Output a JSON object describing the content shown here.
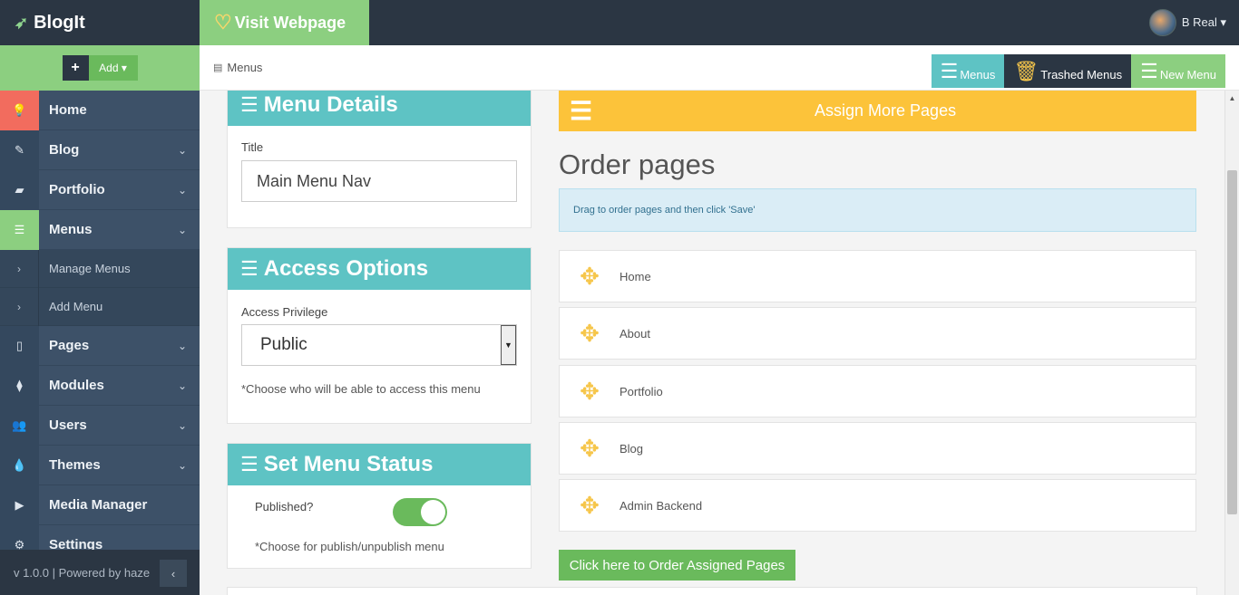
{
  "brand": {
    "name": "BlogIt",
    "icon": "rocket-icon"
  },
  "add_button": {
    "plus": "+",
    "label": "Add ▾"
  },
  "sidebar": {
    "items": [
      {
        "label": "Home",
        "icon": "lightbulb-icon",
        "glyph": "💡",
        "chevron": ""
      },
      {
        "label": "Blog",
        "icon": "edit-icon",
        "glyph": "✎",
        "chevron": "⌄"
      },
      {
        "label": "Portfolio",
        "icon": "briefcase-icon",
        "glyph": "▰",
        "chevron": "⌄"
      },
      {
        "label": "Menus",
        "icon": "list-icon",
        "glyph": "☰",
        "chevron": "⌄"
      },
      {
        "label": "Pages",
        "icon": "file-icon",
        "glyph": "▯",
        "chevron": "⌄"
      },
      {
        "label": "Modules",
        "icon": "sitemap-icon",
        "glyph": "⧫",
        "chevron": "⌄"
      },
      {
        "label": "Users",
        "icon": "users-icon",
        "glyph": "👥",
        "chevron": "⌄"
      },
      {
        "label": "Themes",
        "icon": "droplet-icon",
        "glyph": "💧",
        "chevron": "⌄"
      },
      {
        "label": "Media Manager",
        "icon": "video-icon",
        "glyph": "▶",
        "chevron": ""
      },
      {
        "label": "Settings",
        "icon": "cogs-icon",
        "glyph": "⚙",
        "chevron": ""
      }
    ],
    "subitems": [
      {
        "label": "Manage Menus",
        "glyph": "›"
      },
      {
        "label": "Add Menu",
        "glyph": "›"
      }
    ],
    "footer": "v 1.0.0 | Powered by haze",
    "collapse_glyph": "‹"
  },
  "topbar": {
    "visit_label": "Visit Webpage",
    "visit_icon_glyph": "♡",
    "user_name": "B Real ▾"
  },
  "breadcrumb": {
    "icon_glyph": "▤",
    "label": "Menus"
  },
  "toolbar": {
    "menus_label": "Menus",
    "trashed_label": "Trashed Menus",
    "new_menu_label": "New Menu",
    "list_glyph": "☰",
    "trash_glyph": "🗑"
  },
  "menu_details": {
    "heading": "Menu Details",
    "title_label": "Title",
    "title_value": "Main Menu Nav"
  },
  "access_options": {
    "heading": "Access Options",
    "privilege_label": "Access Privilege",
    "privilege_value": "Public",
    "hint": "*Choose who will be able to access this menu"
  },
  "menu_status": {
    "heading": "Set Menu Status",
    "published_label": "Published?",
    "published": true,
    "hint": "*Choose for publish/unpublish menu"
  },
  "assign": {
    "label": "Assign More Pages",
    "glyph": "☰"
  },
  "order": {
    "title": "Order pages",
    "info": "Drag to order pages and then click 'Save'",
    "move_glyph": "✥",
    "pages": [
      "Home",
      "About",
      "Portfolio",
      "Blog",
      "Admin Backend"
    ],
    "button": "Click here to Order Assigned Pages"
  },
  "heading_glyph": "☰",
  "colors": {
    "accent_teal": "#5ec3c4",
    "accent_green": "#8ccf80",
    "accent_yellow": "#fcc33a",
    "sidebar_bg": "#3d5168",
    "topbar_bg": "#2b3643",
    "home_icon_bg": "#f26c5e"
  }
}
